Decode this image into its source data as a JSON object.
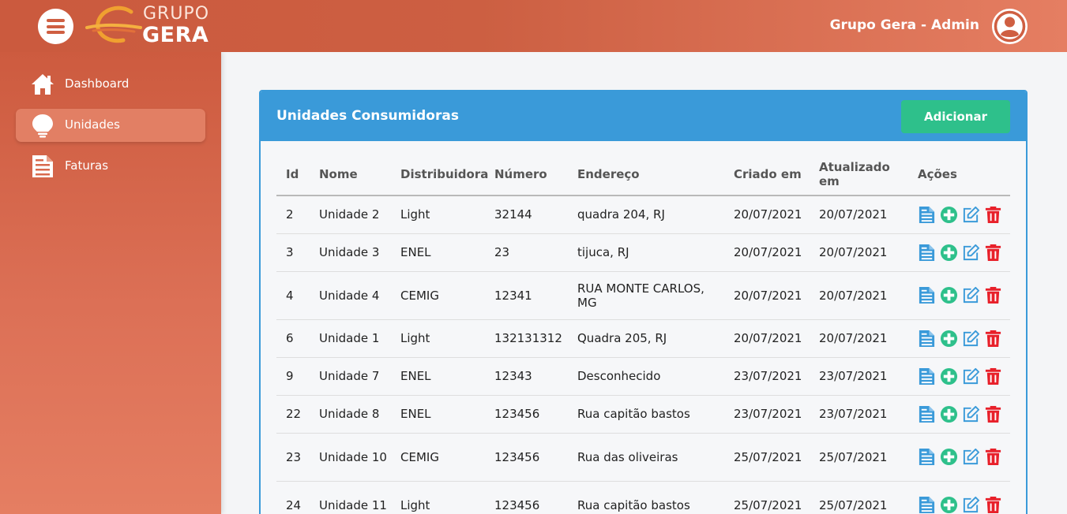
{
  "header": {
    "logo_top": "GRUPO",
    "logo_bottom": "GERA",
    "user_name": "Grupo Gera - Admin"
  },
  "sidebar": {
    "items": [
      {
        "label": "Dashboard",
        "icon": "home-icon",
        "active": false
      },
      {
        "label": "Unidades",
        "icon": "lightbulb-icon",
        "active": true
      },
      {
        "label": "Faturas",
        "icon": "invoice-icon",
        "active": false
      }
    ]
  },
  "card": {
    "title": "Unidades Consumidoras",
    "add_label": "Adicionar"
  },
  "table": {
    "headers": [
      "Id",
      "Nome",
      "Distribuidora",
      "Número",
      "Endereço",
      "Criado em",
      "Atualizado em",
      "Ações"
    ],
    "rows": [
      {
        "id": "2",
        "nome": "Unidade 2",
        "distribuidora": "Light",
        "numero": "32144",
        "endereco": "quadra 204, RJ",
        "criado": "20/07/2021",
        "atualizado": "20/07/2021"
      },
      {
        "id": "3",
        "nome": "Unidade 3",
        "distribuidora": "ENEL",
        "numero": "23",
        "endereco": "tijuca, RJ",
        "criado": "20/07/2021",
        "atualizado": "20/07/2021"
      },
      {
        "id": "4",
        "nome": "Unidade 4",
        "distribuidora": "CEMIG",
        "numero": "12341",
        "endereco": "RUA MONTE CARLOS, MG",
        "criado": "20/07/2021",
        "atualizado": "20/07/2021"
      },
      {
        "id": "6",
        "nome": "Unidade 1",
        "distribuidora": "Light",
        "numero": "132131312",
        "endereco": "Quadra 205, RJ",
        "criado": "20/07/2021",
        "atualizado": "20/07/2021"
      },
      {
        "id": "9",
        "nome": "Unidade 7",
        "distribuidora": "ENEL",
        "numero": "12343",
        "endereco": "Desconhecido",
        "criado": "23/07/2021",
        "atualizado": "23/07/2021"
      },
      {
        "id": "22",
        "nome": "Unidade 8",
        "distribuidora": "ENEL",
        "numero": "123456",
        "endereco": "Rua capitão bastos",
        "criado": "23/07/2021",
        "atualizado": "23/07/2021"
      },
      {
        "id": "23",
        "nome": "Unidade 10",
        "distribuidora": "CEMIG",
        "numero": "123456",
        "endereco": "Rua das oliveiras",
        "criado": "25/07/2021",
        "atualizado": "25/07/2021"
      },
      {
        "id": "24",
        "nome": "Unidade 11",
        "distribuidora": "Light",
        "numero": "123456",
        "endereco": "Rua capitão bastos",
        "criado": "25/07/2021",
        "atualizado": "25/07/2021"
      }
    ],
    "action_icons": [
      "invoice-icon",
      "plus-circle-icon",
      "edit-icon",
      "trash-icon"
    ]
  },
  "colors": {
    "header_start": "#cb5a3e",
    "header_end": "#e57e62",
    "card_blue": "#3a9ad9",
    "add_green": "#2ec08b",
    "delete_red": "#e8202a"
  }
}
